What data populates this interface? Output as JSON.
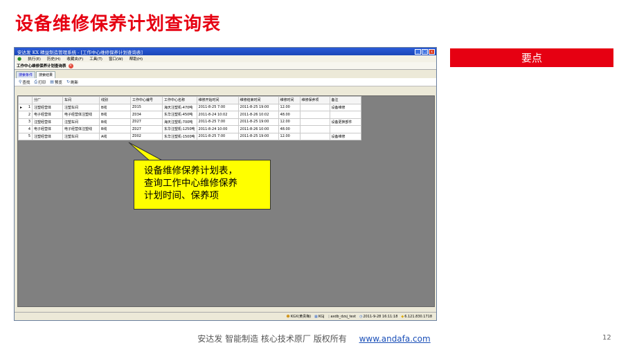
{
  "slide": {
    "title": "设备维修保养计划查询表",
    "keypoint": "要点",
    "footer_text": "安达发  智能制造 核心技术原厂  版权所有",
    "footer_link": "www.andafa.com",
    "page_number": "12",
    "callout": [
      "设备维修保养计划表，",
      "查询工作中心维修保养",
      "计划时间、保养项"
    ]
  },
  "colors": {
    "accent": "#e60012",
    "callout": "#ffff00",
    "titlebar": "#2a5bd7"
  },
  "app": {
    "window_title": "安达发 KX 精益制造管理系统 - [工作中心维修保养计划查询表]",
    "menu": [
      "执行(E)",
      "历史(H)",
      "收藏夹(F)",
      "工具(T)",
      "窗口(W)",
      "帮助(H)"
    ],
    "doc_tab": "工作中心维修保养计划查询表",
    "subtabs": [
      "搜索条件",
      "搜索结果"
    ],
    "toolbar": [
      {
        "label": "查找",
        "icon": "binoculars-icon"
      },
      {
        "label": "打印",
        "icon": "printer-icon"
      },
      {
        "label": "预览",
        "icon": "preview-icon"
      },
      {
        "label": "刷新",
        "icon": "refresh-icon"
      }
    ],
    "table": {
      "headers": [
        "",
        "分厂",
        "车间",
        "线别",
        "工作中心编号",
        "工作中心名称",
        "维修开始时间",
        "维修结束时间",
        "维修时间",
        "维修保养项",
        "备注"
      ],
      "rows": [
        [
          "1",
          "注塑经营体",
          "注塑车间",
          "B线",
          "Z015",
          "海天注塑机-470吨",
          "2011-8-25 7:00",
          "2011-8-25 19:00",
          "12.00",
          "",
          "设备维修"
        ],
        [
          "2",
          "电子经营体",
          "电子经营体注塑线",
          "B线",
          "Z034",
          "东华注塑机-450吨",
          "2011-8-24 10:02",
          "2011-8-26 10:02",
          "48.00",
          "",
          ""
        ],
        [
          "3",
          "注塑经营体",
          "注塑车间",
          "B线",
          "Z027",
          "海天注塑机-700吨",
          "2011-8-25 7:00",
          "2011-8-25 19:00",
          "12.00",
          "",
          "设备更换部件"
        ],
        [
          "4",
          "电子经营体",
          "电子经营体注塑线",
          "B线",
          "Z027",
          "东华注塑机-1250吨",
          "2011-8-24 10:00",
          "2011-8-26 10:00",
          "48.00",
          "",
          ""
        ],
        [
          "5",
          "注塑经营体",
          "注塑车间",
          "A线",
          "Z002",
          "东华注塑机-1500吨",
          "2011-8-25 7:00",
          "2011-8-25 19:00",
          "12.00",
          "",
          "设备维修"
        ]
      ]
    },
    "status": [
      "KGX(黄贵梅)",
      "KGJ",
      "axdb_dzsj_test",
      "2011-9-28 16:11:18",
      "6.121.830.1718"
    ]
  }
}
